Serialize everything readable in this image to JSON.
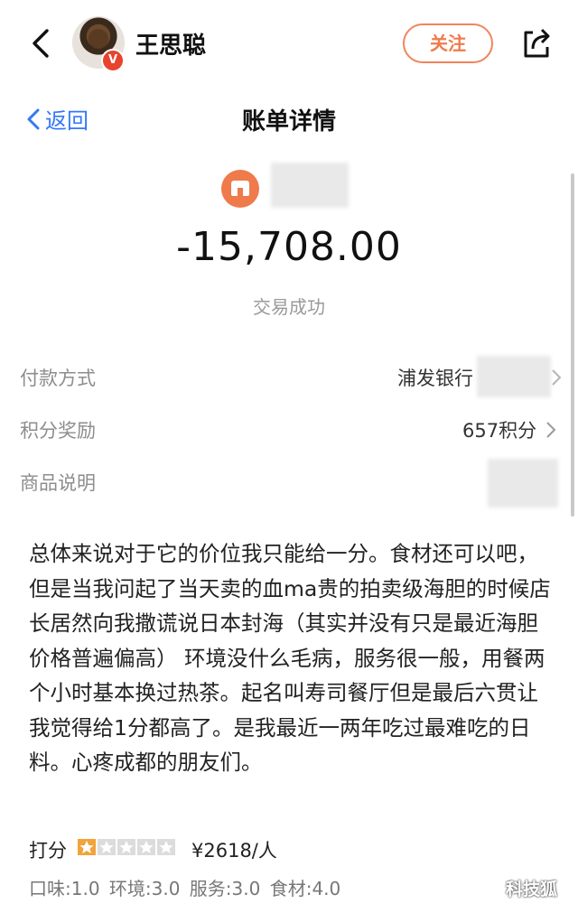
{
  "header": {
    "user_name": "王思聪",
    "verified_badge": "V",
    "follow_label": "关注"
  },
  "bill": {
    "back_label": "返回",
    "title": "账单详情",
    "amount": "-15,708.00",
    "status": "交易成功"
  },
  "details": {
    "rows": [
      {
        "label": "付款方式",
        "value": "浦发银行"
      },
      {
        "label": "积分奖励",
        "value": "657积分"
      },
      {
        "label": "商品说明",
        "value": ""
      }
    ]
  },
  "review": {
    "text": "总体来说对于它的价位我只能给一分。食材还可以吧，但是当我问起了当天卖的血ma贵的拍卖级海胆的时候店长居然向我撒谎说日本封海（其实并没有只是最近海胆价格普遍偏高） 环境没什么毛病，服务很一般，用餐两个小时基本换过热茶。起名叫寿司餐厅但是最后六贯让我觉得给1分都高了。是我最近一两年吃过最难吃的日料。心疼成都的朋友们。",
    "rating_label": "打分",
    "rating": 1,
    "rating_max": 5,
    "price": "¥2618/人",
    "scores": "口味:1.0   环境:3.0   服务:3.0   食材:4.0"
  },
  "watermark": "科技狐",
  "colors": {
    "accent_orange": "#ef7a4c",
    "link_blue": "#3478f6",
    "badge_red": "#e8432d"
  }
}
